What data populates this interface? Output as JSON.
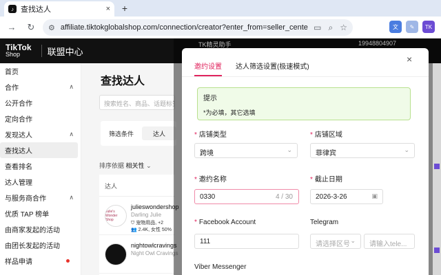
{
  "browser": {
    "tab_title": "查找达人",
    "tab_close": "×",
    "new_tab": "+",
    "url": "affiliate.tiktokglobalshop.com/connection/creator?enter_from=seller_center_entry&s..."
  },
  "header": {
    "logo_line1": "TikTok",
    "logo_line2": "Shop",
    "title": "联盟中心"
  },
  "sidebar": {
    "items": [
      {
        "label": "首页"
      },
      {
        "label": "合作",
        "chevron": "∧"
      },
      {
        "label": "公开合作"
      },
      {
        "label": "定向合作"
      },
      {
        "label": "发现达人",
        "chevron": "∧"
      },
      {
        "label": "查找达人"
      },
      {
        "label": "查看排名"
      },
      {
        "label": "达人管理"
      },
      {
        "label": "与服务商合作",
        "chevron": "∧"
      },
      {
        "label": "优质 TAP 榜单"
      },
      {
        "label": "由商家发起的活动"
      },
      {
        "label": "由团长发起的活动"
      },
      {
        "label": "样品申请"
      }
    ]
  },
  "main": {
    "title": "查找达人",
    "search_placeholder": "搜索姓名、商品、话题标签",
    "filter_label": "筛选条件",
    "filter_chip": "达人",
    "sort_prefix": "排序依据",
    "sort_value": "相关性",
    "list_header": "达人",
    "rows": [
      {
        "avatar_text": "Julie's Wonder Shop",
        "name": "julieswondershop",
        "sub": "Darling Julie",
        "meta": "宠物用品, +2",
        "meta2": "2.4K, 女性 50%"
      },
      {
        "avatar_text": "",
        "name": "nightowlcravings",
        "sub": "Night Owl Cravings",
        "meta": "",
        "meta2": ""
      }
    ]
  },
  "overlay": {
    "header_text": "TK精灵助手",
    "header_num": "19948804907"
  },
  "modal": {
    "close": "×",
    "tabs": [
      "邀约设置",
      "达人筛选设置(极速模式)"
    ],
    "notice_title": "提示",
    "notice_text": "*为必填，其它选填",
    "fields": {
      "shop_type_label": "店铺类型",
      "shop_type_value": "跨境",
      "shop_region_label": "店铺区域",
      "shop_region_value": "菲律宾",
      "invite_name_label": "邀约名称",
      "invite_name_value": "0330",
      "invite_name_count": "4 / 30",
      "deadline_label": "截止日期",
      "deadline_value": "2026-3-26",
      "facebook_label": "Facebook Account",
      "facebook_value": "111",
      "telegram_label": "Telegram",
      "telegram_area_placeholder": "请选择区号",
      "telegram_input_placeholder": "请输入tele...",
      "viber_label": "Viber Messenger"
    }
  },
  "colors": {
    "accent": "#e0245e",
    "notice_bg": "#f0fbe8",
    "header_bg": "#111111"
  }
}
